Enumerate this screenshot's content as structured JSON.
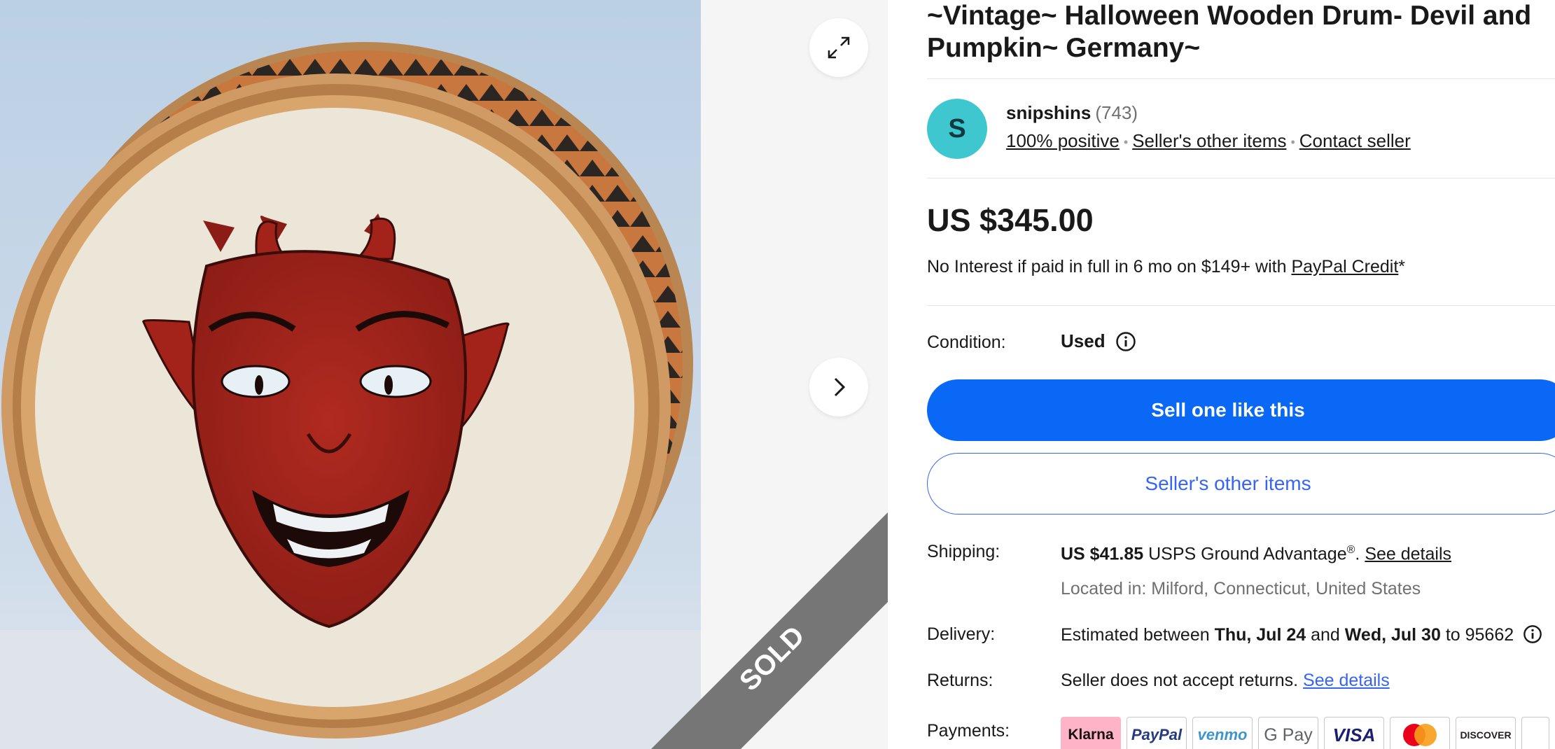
{
  "sold_ribbon": {
    "label": "SOLD"
  },
  "gallery": {
    "expand_icon": "expand-arrows-icon",
    "next_icon": "chevron-right-icon"
  },
  "listing": {
    "title_line1": "~Vintage~ Halloween Wooden Drum- Devil and",
    "title_line2": "Pumpkin~ Germany~"
  },
  "seller": {
    "avatar_letter": "S",
    "name": "snipshins",
    "feedback_count": "(743)",
    "positive": "100% positive",
    "other_items_link": "Seller's other items",
    "contact_link": "Contact seller"
  },
  "price": {
    "amount": "US $345.00",
    "financing_text": "No Interest if paid in full in 6 mo on $149+ with ",
    "financing_link": "PayPal Credit",
    "financing_suffix": "*"
  },
  "condition": {
    "label": "Condition:",
    "value": "Used",
    "info_icon": "info-icon"
  },
  "buttons": {
    "primary": "Sell one like this",
    "secondary": "Seller's other items"
  },
  "shipping": {
    "label": "Shipping:",
    "cost": "US $41.85",
    "service": " USPS Ground Advantage",
    "registered": "®",
    "period": ". ",
    "details_link": "See details",
    "location": "Located in: Milford, Connecticut, United States"
  },
  "delivery": {
    "label": "Delivery:",
    "prefix": "Estimated between ",
    "start": "Thu, Jul 24",
    "and": " and ",
    "end": "Wed, Jul 30",
    "to": " to 95662"
  },
  "returns": {
    "label": "Returns:",
    "text": "Seller does not accept returns. ",
    "details_link": "See details"
  },
  "payments": {
    "label": "Payments:",
    "methods": [
      "Klarna",
      "PayPal",
      "venmo",
      "G Pay",
      "VISA",
      "mastercard",
      "DISCOVER"
    ]
  },
  "colors": {
    "primary_button": "#0968f6",
    "link_blue": "#3665f3",
    "avatar": "#3fc7d0",
    "sold_ribbon": "#767676",
    "devil_red": "#a3231b"
  }
}
